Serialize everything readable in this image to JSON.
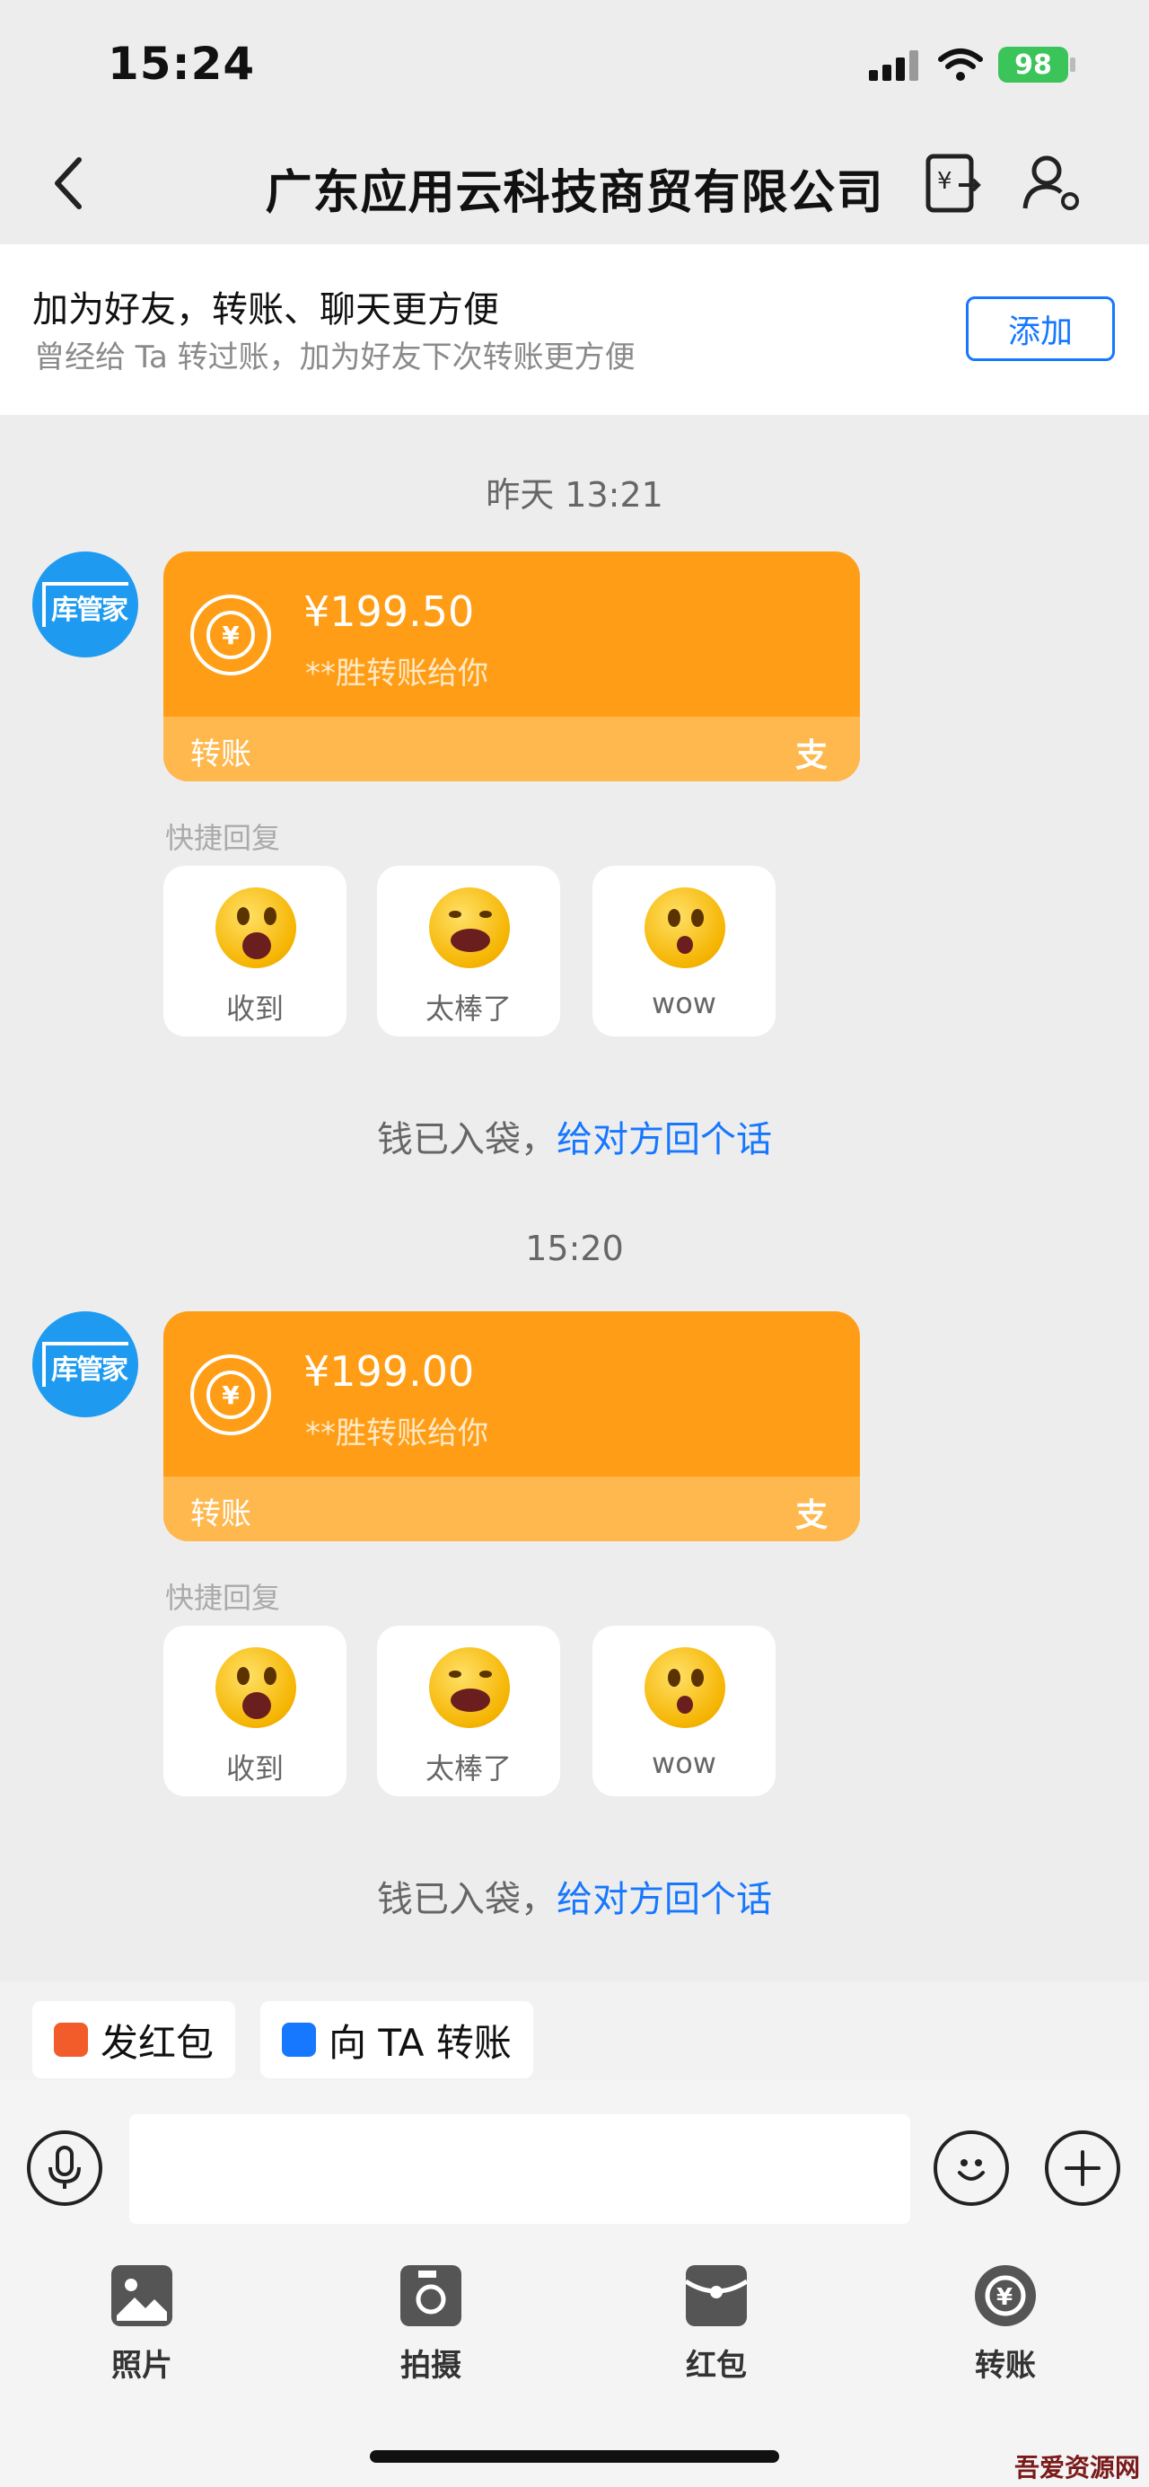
{
  "status_bar": {
    "time": "15:24",
    "battery": "98"
  },
  "nav": {
    "title": "广东应用云科技商贸有限公司"
  },
  "friend_banner": {
    "title": "加为好友，转账、聊天更方便",
    "subtitle": "曾经给 Ta 转过账，加为好友下次转账更方便",
    "add_label": "添加"
  },
  "avatar_text": "库管家",
  "messages": [
    {
      "time": "昨天 13:21",
      "amount": "¥199.50",
      "sender": "**胜转账给你",
      "card_label": "转账",
      "quick_reply_label": "快捷回复",
      "quick_replies": [
        "收到",
        "太棒了",
        "wow"
      ],
      "reply_prompt": "钱已入袋，",
      "reply_link": "给对方回个话"
    },
    {
      "time": "15:20",
      "amount": "¥199.00",
      "sender": "**胜转账给你",
      "card_label": "转账",
      "quick_reply_label": "快捷回复",
      "quick_replies": [
        "收到",
        "太棒了",
        "wow"
      ],
      "reply_prompt": "钱已入袋，",
      "reply_link": "给对方回个话"
    }
  ],
  "shortcuts": {
    "red_packet": "发红包",
    "transfer": "向 TA 转账"
  },
  "toolbar": [
    "照片",
    "拍摄",
    "红包",
    "转账"
  ],
  "watermark": "吾爱资源网",
  "colors": {
    "card": "#FF9E16",
    "link": "#1677FF",
    "avatar": "#1E9BF0",
    "battery": "#3BC45A"
  }
}
